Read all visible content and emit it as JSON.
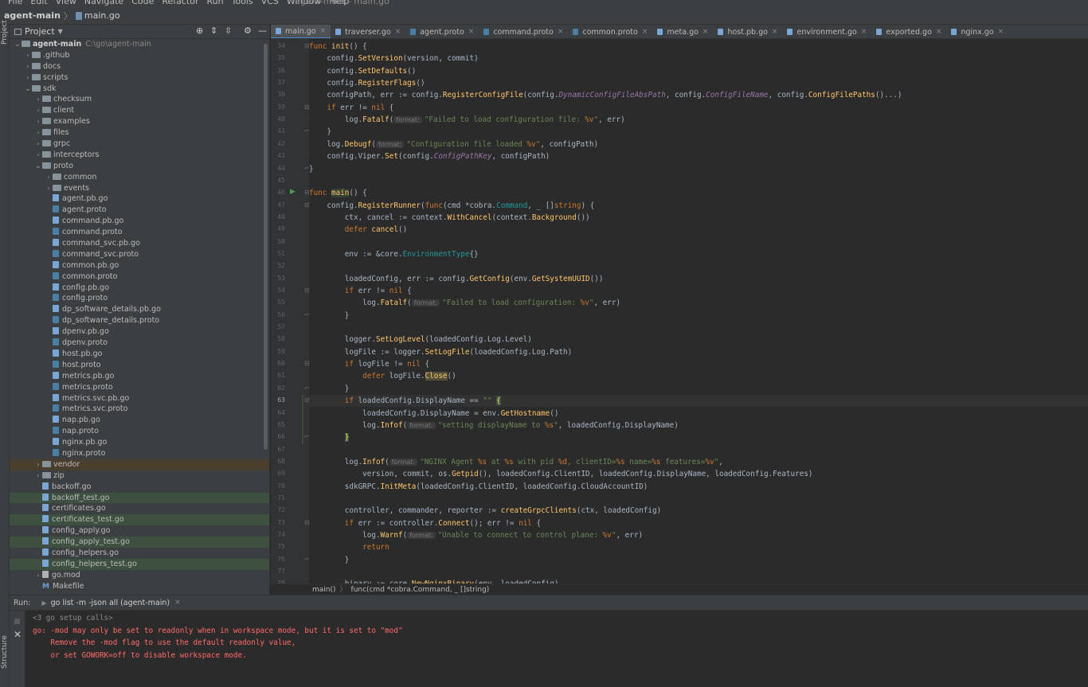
{
  "menu": [
    "File",
    "Edit",
    "View",
    "Navigate",
    "Code",
    "Refactor",
    "Run",
    "Tools",
    "VCS",
    "Window",
    "Help"
  ],
  "window_title": "agent-main - main.go",
  "navbar": {
    "project": "agent-main",
    "file": "main.go"
  },
  "left_strip": {
    "project": "Project",
    "structure": "Structure"
  },
  "project_panel": {
    "title": "Project",
    "tree": [
      {
        "label": "agent-main",
        "path": "C:\\go\\agent-main",
        "type": "folder",
        "depth": 0,
        "open": true,
        "bold": true
      },
      {
        "label": ".github",
        "type": "folder",
        "depth": 1,
        "open": false
      },
      {
        "label": "docs",
        "type": "folder",
        "depth": 1,
        "open": false
      },
      {
        "label": "scripts",
        "type": "folder",
        "depth": 1,
        "open": false
      },
      {
        "label": "sdk",
        "type": "folder",
        "depth": 1,
        "open": true
      },
      {
        "label": "checksum",
        "type": "folder",
        "depth": 2,
        "open": false
      },
      {
        "label": "client",
        "type": "folder",
        "depth": 2,
        "open": false
      },
      {
        "label": "examples",
        "type": "folder",
        "depth": 2,
        "open": false
      },
      {
        "label": "files",
        "type": "folder",
        "depth": 2,
        "open": false
      },
      {
        "label": "grpc",
        "type": "folder",
        "depth": 2,
        "open": false
      },
      {
        "label": "interceptors",
        "type": "folder",
        "depth": 2,
        "open": false
      },
      {
        "label": "proto",
        "type": "folder",
        "depth": 2,
        "open": true
      },
      {
        "label": "common",
        "type": "folder",
        "depth": 3,
        "open": false
      },
      {
        "label": "events",
        "type": "folder",
        "depth": 3,
        "open": false
      },
      {
        "label": "agent.pb.go",
        "type": "go",
        "depth": 3
      },
      {
        "label": "agent.proto",
        "type": "proto",
        "depth": 3
      },
      {
        "label": "command.pb.go",
        "type": "go",
        "depth": 3
      },
      {
        "label": "command.proto",
        "type": "proto",
        "depth": 3
      },
      {
        "label": "command_svc.pb.go",
        "type": "go",
        "depth": 3
      },
      {
        "label": "command_svc.proto",
        "type": "proto",
        "depth": 3
      },
      {
        "label": "common.pb.go",
        "type": "go",
        "depth": 3
      },
      {
        "label": "common.proto",
        "type": "proto",
        "depth": 3
      },
      {
        "label": "config.pb.go",
        "type": "go",
        "depth": 3
      },
      {
        "label": "config.proto",
        "type": "proto",
        "depth": 3
      },
      {
        "label": "dp_software_details.pb.go",
        "type": "go",
        "depth": 3
      },
      {
        "label": "dp_software_details.proto",
        "type": "proto",
        "depth": 3
      },
      {
        "label": "dpenv.pb.go",
        "type": "go",
        "depth": 3
      },
      {
        "label": "dpenv.proto",
        "type": "proto",
        "depth": 3
      },
      {
        "label": "host.pb.go",
        "type": "go",
        "depth": 3
      },
      {
        "label": "host.proto",
        "type": "proto",
        "depth": 3
      },
      {
        "label": "metrics.pb.go",
        "type": "go",
        "depth": 3
      },
      {
        "label": "metrics.proto",
        "type": "proto",
        "depth": 3
      },
      {
        "label": "metrics.svc.pb.go",
        "type": "go",
        "depth": 3
      },
      {
        "label": "metrics.svc.proto",
        "type": "proto",
        "depth": 3
      },
      {
        "label": "nap.pb.go",
        "type": "go",
        "depth": 3
      },
      {
        "label": "nap.proto",
        "type": "proto",
        "depth": 3
      },
      {
        "label": "nginx.pb.go",
        "type": "go",
        "depth": 3
      },
      {
        "label": "nginx.proto",
        "type": "proto",
        "depth": 3
      },
      {
        "label": "vendor",
        "type": "folder",
        "depth": 2,
        "open": false,
        "hl": "orange"
      },
      {
        "label": "zip",
        "type": "folder",
        "depth": 2,
        "open": false
      },
      {
        "label": "backoff.go",
        "type": "go",
        "depth": 2
      },
      {
        "label": "backoff_test.go",
        "type": "go",
        "depth": 2,
        "hl": "green"
      },
      {
        "label": "certificates.go",
        "type": "go",
        "depth": 2
      },
      {
        "label": "certificates_test.go",
        "type": "go",
        "depth": 2,
        "hl": "green"
      },
      {
        "label": "config_apply.go",
        "type": "go",
        "depth": 2
      },
      {
        "label": "config_apply_test.go",
        "type": "go",
        "depth": 2,
        "hl": "green"
      },
      {
        "label": "config_helpers.go",
        "type": "go",
        "depth": 2
      },
      {
        "label": "config_helpers_test.go",
        "type": "go",
        "depth": 2,
        "hl": "green"
      },
      {
        "label": "go.mod",
        "type": "mod",
        "depth": 2,
        "open": false
      },
      {
        "label": "Makefile",
        "type": "make",
        "depth": 2
      }
    ]
  },
  "tabs": [
    {
      "label": "main.go",
      "type": "go",
      "active": true
    },
    {
      "label": "traverser.go",
      "type": "go"
    },
    {
      "label": "agent.proto",
      "type": "proto"
    },
    {
      "label": "command.proto",
      "type": "proto"
    },
    {
      "label": "common.proto",
      "type": "proto"
    },
    {
      "label": "meta.go",
      "type": "go"
    },
    {
      "label": "host.pb.go",
      "type": "go"
    },
    {
      "label": "environment.go",
      "type": "go"
    },
    {
      "label": "exported.go",
      "type": "go"
    },
    {
      "label": "nginx.go",
      "type": "go"
    }
  ],
  "editor": {
    "first_line": 34,
    "current_line": 63,
    "lines": [
      "<span class=\"kw\">func</span> <span class=\"fn\">init</span>() {",
      "    config.<span class=\"mc\">SetVersion</span>(version, commit)",
      "    config.<span class=\"mc\">SetDefaults</span>()",
      "    config.<span class=\"mc\">RegisterFlags</span>()",
      "    configPath, err := config.<span class=\"mc\">RegisterConfigFile</span>(config.<span class=\"pc\"><i>DynamicConfigFileAbsPath</i></span>, config.<span class=\"pc\"><i>ConfigFileName</i></span>, config.<span class=\"mc\">ConfigFilePaths</span>()...)",
      "    <span class=\"kw\">if</span> err != <span class=\"kw\">nil</span> {",
      "        log.<span class=\"mc\">Fatalf</span>(<span class=\"hint\">format:</span><span class=\"str\">\"Failed to load configuration file: <span class=\"fmt\">%v</span>\"</span>, err)",
      "    }",
      "    log.<span class=\"mc\">Debugf</span>(<span class=\"hint\">format:</span><span class=\"str\">\"Configuration file loaded <span class=\"fmt\">%v</span>\"</span>, configPath)",
      "    config.Viper.<span class=\"mc\">Set</span>(config.<span class=\"pc\"><i>ConfigPathKey</i></span>, configPath)",
      "}",
      "",
      "<span class=\"kw\">func</span> <span class=\"fn wu\">main</span>() {",
      "    config.<span class=\"mc\">RegisterRunner</span>(<span class=\"kw\">func</span>(cmd *cobra.<span class=\"tp\">Command</span>, _ []<span class=\"kw\">string</span>) {",
      "        ctx, cancel := context.<span class=\"mc\">WithCancel</span>(context.<span class=\"mc\">Background</span>())",
      "        <span class=\"kw\">defer</span> <span class=\"mc\">cancel</span>()",
      "",
      "        env := &amp;core.<span class=\"tp\">EnvironmentType</span>{}",
      "",
      "        loadedConfig, err := config.<span class=\"mc\">GetConfig</span>(env.<span class=\"mc\">GetSystemUUID</span>())",
      "        <span class=\"kw\">if</span> err != <span class=\"kw\">nil</span> {",
      "            log.<span class=\"mc\">Fatalf</span>(<span class=\"hint\">format:</span><span class=\"str\">\"Failed to load configuration: <span class=\"fmt\">%v</span>\"</span>, err)",
      "        }",
      "",
      "        logger.<span class=\"mc\">SetLogLevel</span>(loadedConfig.Log.Level)",
      "        logFile := logger.<span class=\"mc\">SetLogFile</span>(loadedConfig.Log.Path)",
      "        <span class=\"kw\">if</span> logFile != <span class=\"kw\">nil</span> {",
      "            <span class=\"kw\">defer</span> logFile.<span class=\"mc\" style=\"background:#52503a\">Close</span>()",
      "        }",
      "        <span class=\"kw\">if</span> loadedConfig.DisplayName == <span class=\"str\">\"\"</span> <span class=\"brh\">{</span>",
      "            loadedConfig.DisplayName = env.<span class=\"mc\">GetHostname</span>()",
      "            log.<span class=\"mc\">Infof</span>(<span class=\"hint\">format:</span><span class=\"str\">\"setting displayName to <span class=\"fmt\">%s</span>\"</span>, loadedConfig.DisplayName)",
      "        <span class=\"brh\">}</span>",
      "",
      "        log.<span class=\"mc\">Infof</span>(<span class=\"hint\">format:</span><span class=\"str\">\"NGINX Agent <span class=\"fmt\">%s</span> at <span class=\"fmt\">%s</span> with pid <span class=\"fmt\">%d</span>, clientID=<span class=\"fmt\">%s</span> name=<span class=\"fmt\">%s</span> features=<span class=\"fmt\">%v</span>\"</span>,",
      "            version, commit, os.<span class=\"mc\">Getpid</span>(), loadedConfig.ClientID, loadedConfig.DisplayName, loadedConfig.Features)",
      "        sdkGRPC.<span class=\"mc\">InitMeta</span>(loadedConfig.ClientID, loadedConfig.CloudAccountID)",
      "",
      "        controller, commander, reporter := <span class=\"mc\">createGrpcClients</span>(ctx, loadedConfig)",
      "        <span class=\"kw\">if</span> err := controller.<span class=\"mc\">Connect</span>(); err != <span class=\"kw\">nil</span> {",
      "            log.<span class=\"mc\">Warnf</span>(<span class=\"hint\">format:</span><span class=\"str\">\"Unable to connect to control plane: <span class=\"fmt\">%v</span>\"</span>, err)",
      "            <span class=\"kw\">return</span>",
      "        }",
      "",
      "        binary := core.<span class=\"mc\">NewNginxBinary</span>(env, loadedConfig)"
    ]
  },
  "breadcrumb": [
    "main()",
    "func(cmd *cobra.Command, _ []string)"
  ],
  "run_panel": {
    "label": "Run:",
    "tab": "go list -m -json all (agent-main)",
    "lines": [
      {
        "text": "<3 go setup calls>",
        "kind": "meta"
      },
      {
        "text": "go: -mod may only be set to readonly when in workspace mode, but it is set to \"mod\"",
        "kind": "err"
      },
      {
        "text": "    Remove the -mod flag to use the default readonly value,",
        "kind": "err"
      },
      {
        "text": "    or set GOWORK=off to disable workspace mode.",
        "kind": "err"
      }
    ]
  }
}
